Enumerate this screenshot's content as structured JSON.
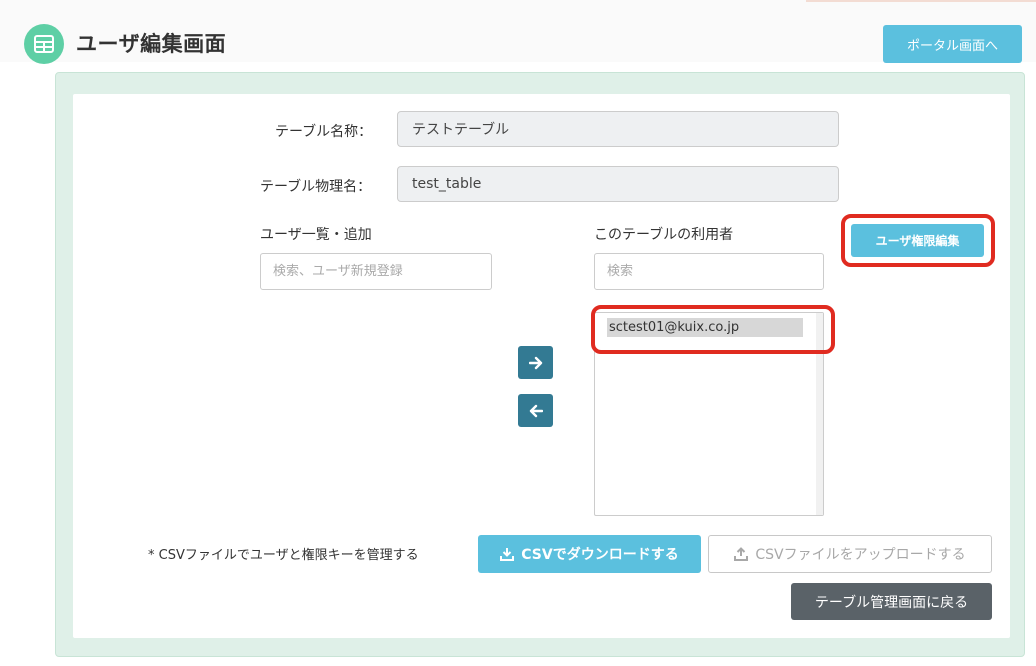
{
  "header": {
    "title": "ユーザ編集画面",
    "portal_button": "ポータル画面へ",
    "icon": "table-icon"
  },
  "form": {
    "table_name_label": "テーブル名称：",
    "table_name_value": "テストテーブル",
    "physical_name_label": "テーブル物理名：",
    "physical_name_value": "test_table"
  },
  "user_list": {
    "heading": "ユーザ一覧・追加",
    "search_placeholder": "検索、ユーザ新規登録"
  },
  "table_users": {
    "heading": "このテーブルの利用者",
    "search_placeholder": "検索",
    "items": [
      "sctest01@kuix.co.jp"
    ],
    "edit_permission_button": "ユーザ権限編集"
  },
  "transfer": {
    "add_icon": "arrow-right-icon",
    "remove_icon": "arrow-left-icon"
  },
  "csv": {
    "note": "* CSVファイルでユーザと権限キーを管理する",
    "download_button": "CSVでダウンロードする",
    "download_icon": "download-icon",
    "upload_button": "CSVファイルをアップロードする",
    "upload_icon": "upload-icon"
  },
  "footer": {
    "back_button": "テーブル管理画面に戻る"
  },
  "colors": {
    "accent": "#5bc0de",
    "panel": "#dff0e8",
    "logo": "#5ecfa5",
    "arrow_button": "#337a93",
    "dark_button": "#5a6268",
    "highlight": "#e02b20"
  }
}
